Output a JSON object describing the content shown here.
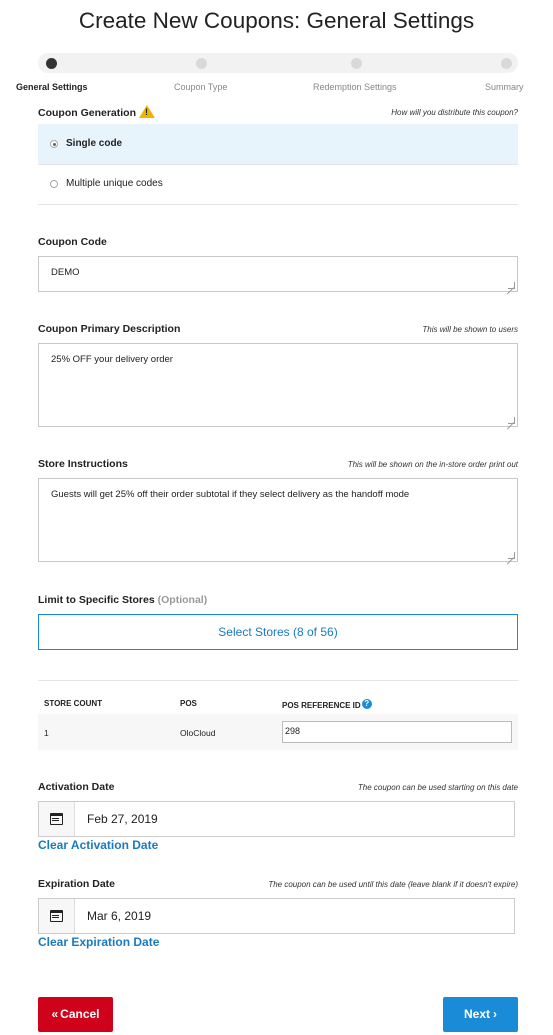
{
  "page_title": "Create New Coupons: General Settings",
  "stepper": {
    "steps": [
      "General Settings",
      "Coupon Type",
      "Redemption Settings",
      "Summary"
    ],
    "active_index": 0
  },
  "coupon_generation": {
    "label": "Coupon Generation",
    "hint": "How will you distribute this coupon?",
    "options": [
      "Single code",
      "Multiple unique codes"
    ],
    "selected": "Single code"
  },
  "coupon_code": {
    "label": "Coupon Code",
    "value": "DEMO"
  },
  "primary_description": {
    "label": "Coupon Primary Description",
    "hint": "This will be shown to users",
    "value": "25% OFF your delivery order"
  },
  "store_instructions": {
    "label": "Store Instructions",
    "hint": "This will be shown on the in-store order print out",
    "value": "Guests will get 25% off their order subtotal if they select delivery as the handoff mode"
  },
  "limit_stores": {
    "label": "Limit to Specific Stores",
    "optional": "(Optional)",
    "button": "Select Stores (8 of 56)"
  },
  "stores_table": {
    "headers": [
      "STORE COUNT",
      "POS",
      "POS REFERENCE ID"
    ],
    "rows": [
      {
        "store_count": "1",
        "pos": "OloCloud",
        "pos_reference_id": "298"
      }
    ]
  },
  "activation_date": {
    "label": "Activation Date",
    "hint": "The coupon can be used starting on this date",
    "value": "Feb 27, 2019",
    "clear": "Clear Activation Date"
  },
  "expiration_date": {
    "label": "Expiration Date",
    "hint": "The coupon can be used until this date (leave blank if it doesn't expire)",
    "value": "Mar 6, 2019",
    "clear": "Clear Expiration Date"
  },
  "footer": {
    "cancel": "Cancel",
    "next": "Next"
  },
  "colors": {
    "primary": "#1a8bd6",
    "danger": "#d0021b",
    "selected_row": "#e8f4fc",
    "warning": "#f0b400"
  }
}
